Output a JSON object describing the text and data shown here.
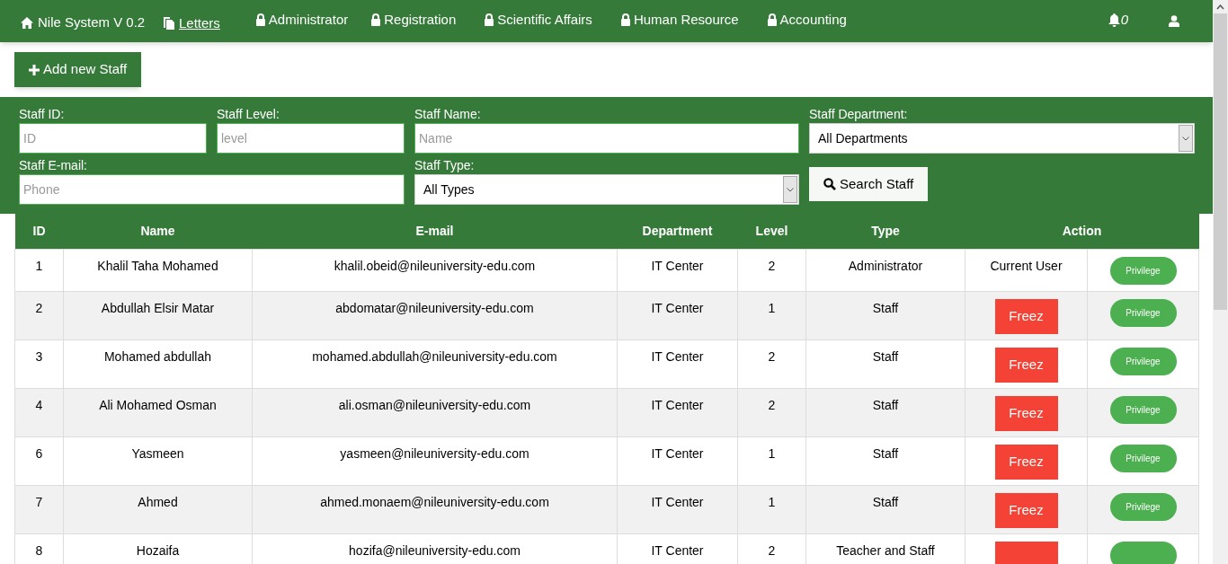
{
  "navbar": {
    "brand": "Nile System V 0.2",
    "items": [
      {
        "label": "Letters",
        "kind": "link"
      },
      {
        "label": "Administrator",
        "kind": "locked"
      },
      {
        "label": "Registration",
        "kind": "locked"
      },
      {
        "label": "Scientific Affairs",
        "kind": "locked"
      },
      {
        "label": "Human Resource",
        "kind": "locked"
      },
      {
        "label": "Accounting",
        "kind": "locked"
      }
    ],
    "notifications": "0"
  },
  "add_button": "Add new Staff",
  "filters": {
    "id": {
      "label": "Staff ID:",
      "placeholder": "ID"
    },
    "level": {
      "label": "Staff Level:",
      "placeholder": "level"
    },
    "name": {
      "label": "Staff Name:",
      "placeholder": "Name"
    },
    "department": {
      "label": "Staff Department:",
      "value": "All Departments"
    },
    "email": {
      "label": "Staff E-mail:",
      "placeholder": "Phone"
    },
    "type": {
      "label": "Staff Type:",
      "value": "All Types"
    },
    "search_button": "Search Staff"
  },
  "table": {
    "columns": [
      "ID",
      "Name",
      "E-mail",
      "Department",
      "Level",
      "Type",
      "Action"
    ],
    "rows": [
      {
        "id": "1",
        "name": "Khalil Taha Mohamed",
        "email": "khalil.obeid@nileuniversity-edu.com",
        "department": "IT Center",
        "level": "2",
        "type": "Administrator",
        "action": {
          "kind": "current",
          "label": "Current User"
        },
        "privilege": "Privilege"
      },
      {
        "id": "2",
        "name": "Abdullah Elsir Matar",
        "email": "abdomatar@nileuniversity-edu.com",
        "department": "IT Center",
        "level": "1",
        "type": "Staff",
        "action": {
          "kind": "freeze",
          "label": "Freez"
        },
        "privilege": "Privilege"
      },
      {
        "id": "3",
        "name": "Mohamed abdullah",
        "email": "mohamed.abdullah@nileuniversity-edu.com",
        "department": "IT Center",
        "level": "2",
        "type": "Staff",
        "action": {
          "kind": "freeze",
          "label": "Freez"
        },
        "privilege": "Privilege"
      },
      {
        "id": "4",
        "name": "Ali Mohamed Osman",
        "email": "ali.osman@nileuniversity-edu.com",
        "department": "IT Center",
        "level": "2",
        "type": "Staff",
        "action": {
          "kind": "freeze",
          "label": "Freez"
        },
        "privilege": "Privilege"
      },
      {
        "id": "6",
        "name": "Yasmeen",
        "email": "yasmeen@nileuniversity-edu.com",
        "department": "IT Center",
        "level": "1",
        "type": "Staff",
        "action": {
          "kind": "freeze",
          "label": "Freez"
        },
        "privilege": "Privilege"
      },
      {
        "id": "7",
        "name": "Ahmed",
        "email": "ahmed.monaem@nileuniversity-edu.com",
        "department": "IT Center",
        "level": "1",
        "type": "Staff",
        "action": {
          "kind": "freeze",
          "label": "Freez"
        },
        "privilege": "Privilege"
      },
      {
        "id": "8",
        "name": "Hozaifa",
        "email": "hozifa@nileuniversity-edu.com",
        "department": "IT Center",
        "level": "2",
        "type": "Teacher and Staff",
        "action": {
          "kind": "freeze"
        }
      }
    ]
  }
}
